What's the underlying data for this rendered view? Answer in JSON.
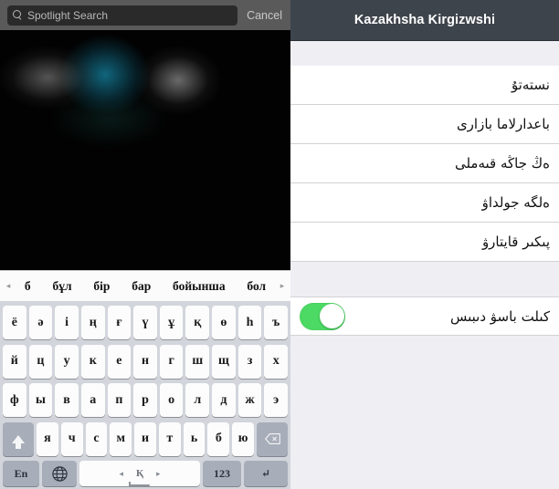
{
  "left_panel": {
    "search": {
      "placeholder": "Spotlight Search",
      "value": "",
      "icon": "search-icon",
      "cancel_label": "Cancel"
    },
    "wallpaper": {
      "description": "blurred dark background",
      "colors": [
        "#020202",
        "#126e87",
        "#969896"
      ]
    },
    "predictive_bar": {
      "left_arrow": "◂",
      "right_arrow": "▸",
      "suggestions": [
        "б",
        "бұл",
        "бір",
        "бар",
        "бойынша",
        "бол"
      ]
    },
    "keyboard": {
      "language": "Kazakh",
      "row1": [
        "ё",
        "ә",
        "і",
        "ң",
        "ғ",
        "ү",
        "ұ",
        "қ",
        "ө",
        "һ",
        "ъ"
      ],
      "row2": [
        "й",
        "ц",
        "у",
        "к",
        "е",
        "н",
        "г",
        "ш",
        "щ",
        "з",
        "х"
      ],
      "row3": [
        "ф",
        "ы",
        "в",
        "а",
        "п",
        "р",
        "о",
        "л",
        "д",
        "ж",
        "э"
      ],
      "row4_letters": [
        "я",
        "ч",
        "с",
        "м",
        "и",
        "т",
        "ь",
        "б",
        "ю"
      ],
      "shift_key": "shift",
      "backspace_key": "backspace",
      "bottom_row": {
        "en_label": "En",
        "globe_label": "globe",
        "space_label": "Қ",
        "space_left_arrow": "◂",
        "space_right_arrow": "▸",
        "numbers_label": "123",
        "return_label": "↵"
      }
    }
  },
  "right_panel": {
    "navbar": {
      "title": "Kazakhsha Kirgizwshi",
      "background": "#3e444b"
    },
    "list_items": [
      {
        "label": "نستەتۇ"
      },
      {
        "label": "باعدارلاما بازارى"
      },
      {
        "label": "ەڭ جاڭە قىەملى"
      },
      {
        "label": "ەلگە جولداۋ"
      },
      {
        "label": "پىكىر قايتارۋ"
      }
    ],
    "toggle_row": {
      "label": "كىلت باسۋ دىبىس",
      "state": "on",
      "on_color": "#4cd964"
    }
  }
}
